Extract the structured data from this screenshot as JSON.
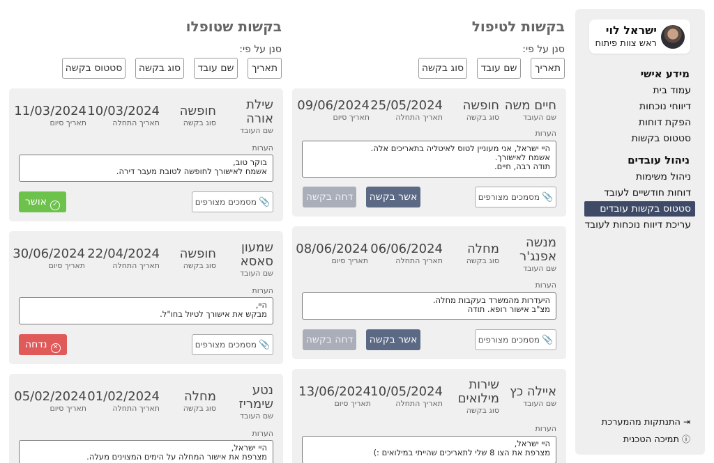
{
  "user": {
    "name": "ישראל לוי",
    "role": "ראש צוות פיתוח"
  },
  "nav": {
    "personal_heading": "מידע אישי",
    "personal_items": [
      "עמוד בית",
      "דיווחי נוכחות",
      "הפקת דוחות",
      "סטטוס בקשות"
    ],
    "manage_heading": "ניהול עובדים",
    "manage_items": [
      "ניהול משימות",
      "דוחות חודשיים לעובד",
      "סטטוס בקשות עובדים",
      "עריכת דיווח נוכחות לעובד"
    ],
    "active_item": "סטטוס בקשות עובדים",
    "logout": "התנתקות מהמערכת",
    "support": "תמיכה הטכנית"
  },
  "labels": {
    "employee_name": "שם העובד",
    "request_type": "סוג בקשה",
    "start_date": "תאריך התחלה",
    "end_date": "תאריך סיום",
    "notes": "הערות",
    "attachments": "מסמכים מצורפים",
    "approve": "אשר בקשה",
    "reject": "דחה בקשה",
    "filter_by": "סנן על פי:"
  },
  "pending": {
    "title": "בקשות לטיפול",
    "filters": [
      "תאריך",
      "שם עובד",
      "סוג בקשה"
    ],
    "requests": [
      {
        "employee": "חיים משה",
        "type": "חופשה",
        "start": "25/05/2024",
        "end": "09/06/2024",
        "notes": [
          "היי ישראל, אני מעוניין לטוס לאיטליה בתאריכים אלה.",
          "אשמח לאישורך.",
          "תודה רבה, חיים."
        ]
      },
      {
        "employee": "מנשה אפנג'ר",
        "type": "מחלה",
        "start": "06/06/2024",
        "end": "08/06/2024",
        "notes": [
          "היעדרות מהמשרד בעקבות מחלה.",
          "מצ\"ב אישור רופא. תודה"
        ]
      },
      {
        "employee": "איילה כץ",
        "type": "שירות מילואים",
        "start": "10/05/2024",
        "end": "13/06/2024",
        "notes": [
          "היי ישראל,",
          "מצרפת את הצו 8 שלי לתאריכים שהייתי במילואים :)"
        ]
      }
    ]
  },
  "handled": {
    "title": "בקשות שטופלו",
    "filters": [
      "תאריך",
      "שם עובד",
      "סוג בקשה",
      "סטטוס בקשה"
    ],
    "requests": [
      {
        "employee": "שילת אורה",
        "type": "חופשה",
        "start": "10/03/2024",
        "end": "11/03/2024",
        "notes": [
          "בוקר טוב,",
          "אשמח לאישורך לחופשה לטובת מעבר דירה."
        ],
        "status": "אושר",
        "status_color": "#6cc24a"
      },
      {
        "employee": "שמעון סאסא",
        "type": "חופשה",
        "start": "22/04/2024",
        "end": "30/06/2024",
        "notes": [
          "היי,",
          "מבקש את אישורך לטיול בחו\"ל."
        ],
        "status": "נדחה",
        "status_color": "#e05a5a"
      },
      {
        "employee": "נטע שימריז",
        "type": "מחלה",
        "start": "01/02/2024",
        "end": "05/02/2024",
        "notes": [
          "היי ישראל,",
          "מצרפת את אישור המחלה על הימים המצוינים מעלה."
        ]
      }
    ]
  }
}
